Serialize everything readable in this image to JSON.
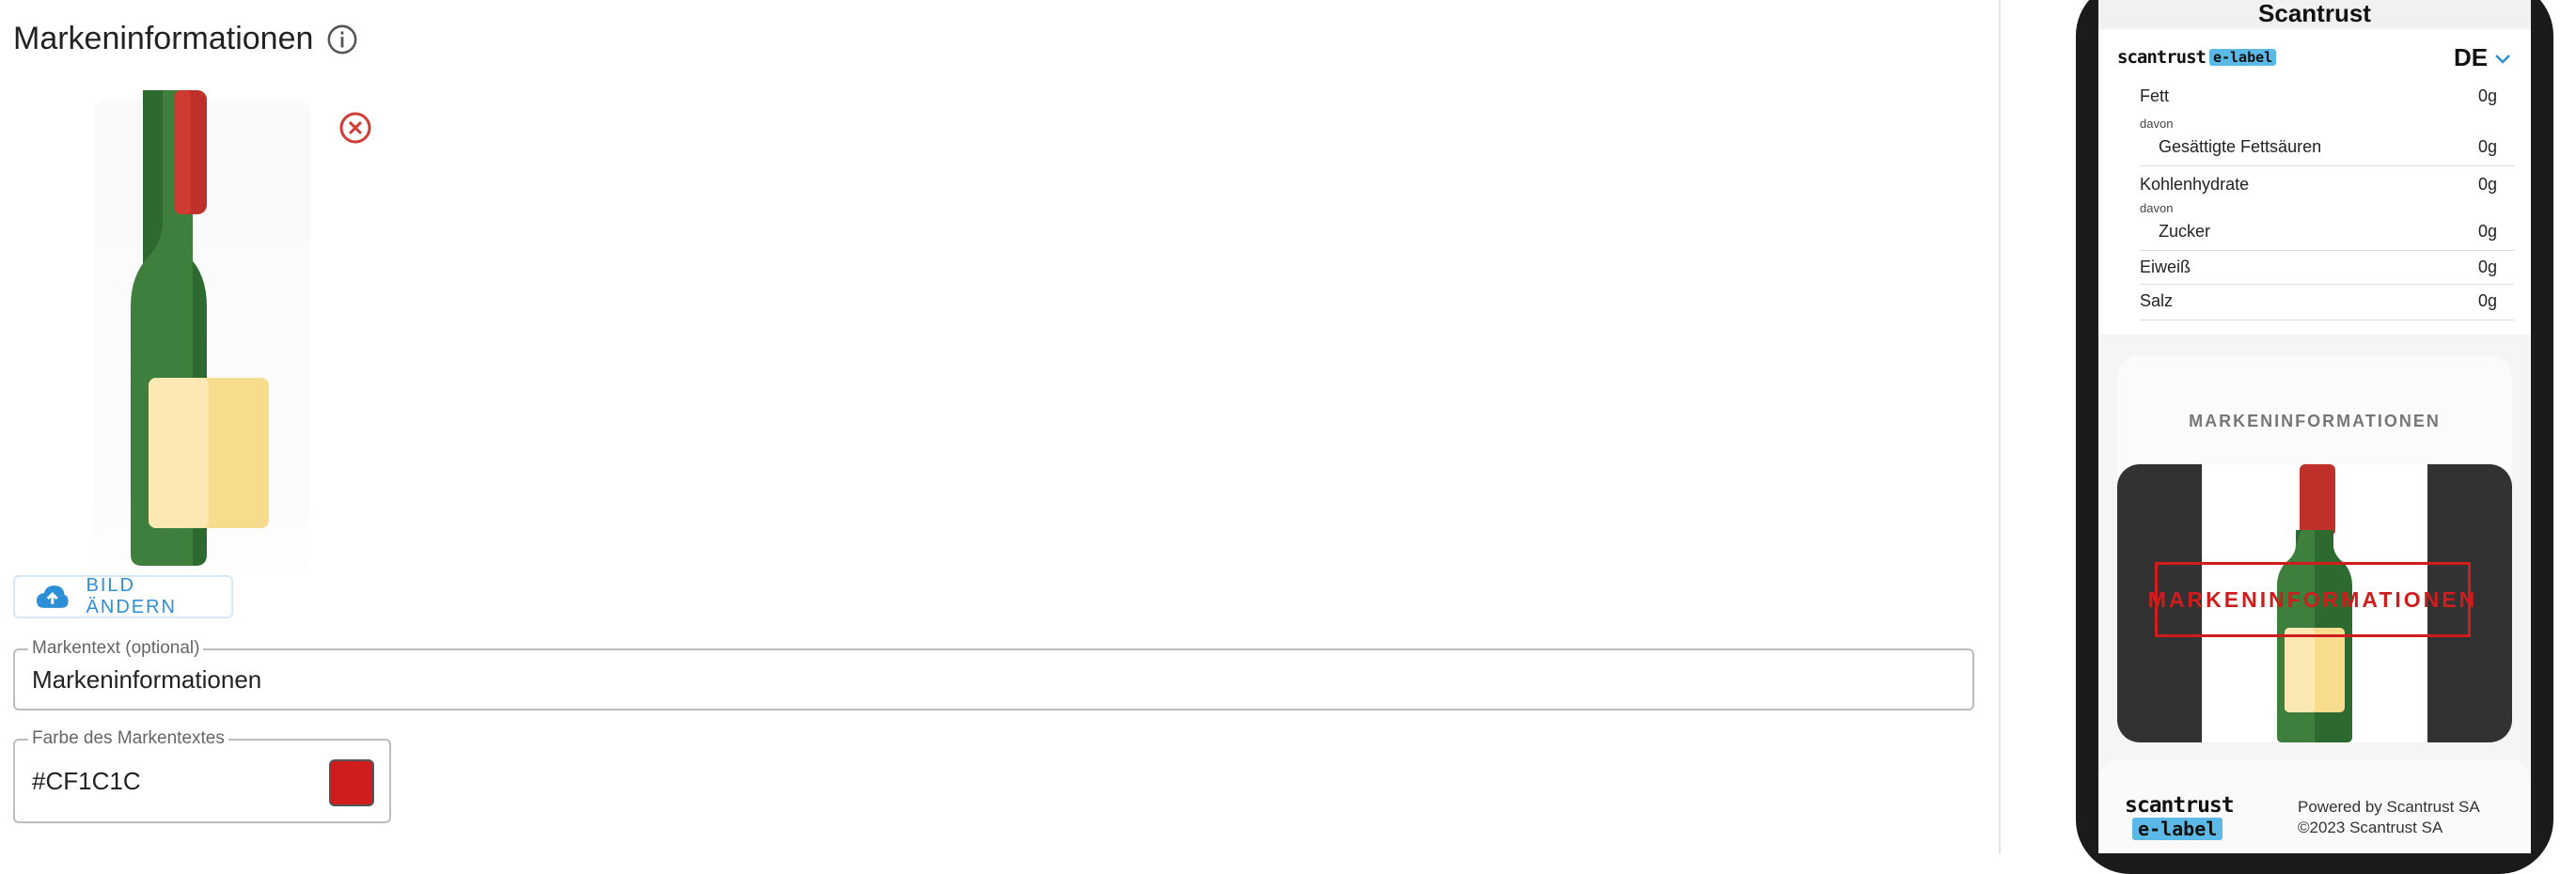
{
  "editor": {
    "section_title": "Markeninformationen",
    "change_image_label": "BILD ÄNDERN",
    "brand_text_field": {
      "label": "Markentext (optional)",
      "value": "Markeninformationen"
    },
    "brand_color_field": {
      "label": "Farbe des Markentextes",
      "value": "#CF1C1C"
    }
  },
  "colors": {
    "brand_text": "#CF1C1C",
    "accent": "#2e8fd9",
    "logo_highlight": "#5ab9e6"
  },
  "icons": {
    "info": "info-icon",
    "remove": "close-circle-icon",
    "upload": "cloud-upload-icon",
    "language_dropdown": "chevron-down-icon"
  },
  "preview": {
    "screen_title": "Scantrust",
    "logo_text": "scantrust",
    "logo_badge": "e-label",
    "language": "DE",
    "nutrition_rows": [
      {
        "label": "Fett",
        "value": "0g"
      },
      {
        "sublabel": "davon"
      },
      {
        "label": "Gesättigte Fettsäuren",
        "value": "0g"
      },
      {
        "label": "Kohlenhydrate",
        "value": "0g"
      },
      {
        "sublabel": "davon"
      },
      {
        "label": "Zucker",
        "value": "0g"
      },
      {
        "label": "Eiweiß",
        "value": "0g"
      },
      {
        "label": "Salz",
        "value": "0g"
      }
    ],
    "brand_section_title": "MARKENINFORMATIONEN",
    "brand_overlay_text": "MARKENINFORMATIONEN",
    "footer": {
      "logo_text": "scantrust",
      "logo_badge": "e-label",
      "powered_by": "Powered by Scantrust SA",
      "copyright": "©2023 Scantrust SA"
    }
  }
}
